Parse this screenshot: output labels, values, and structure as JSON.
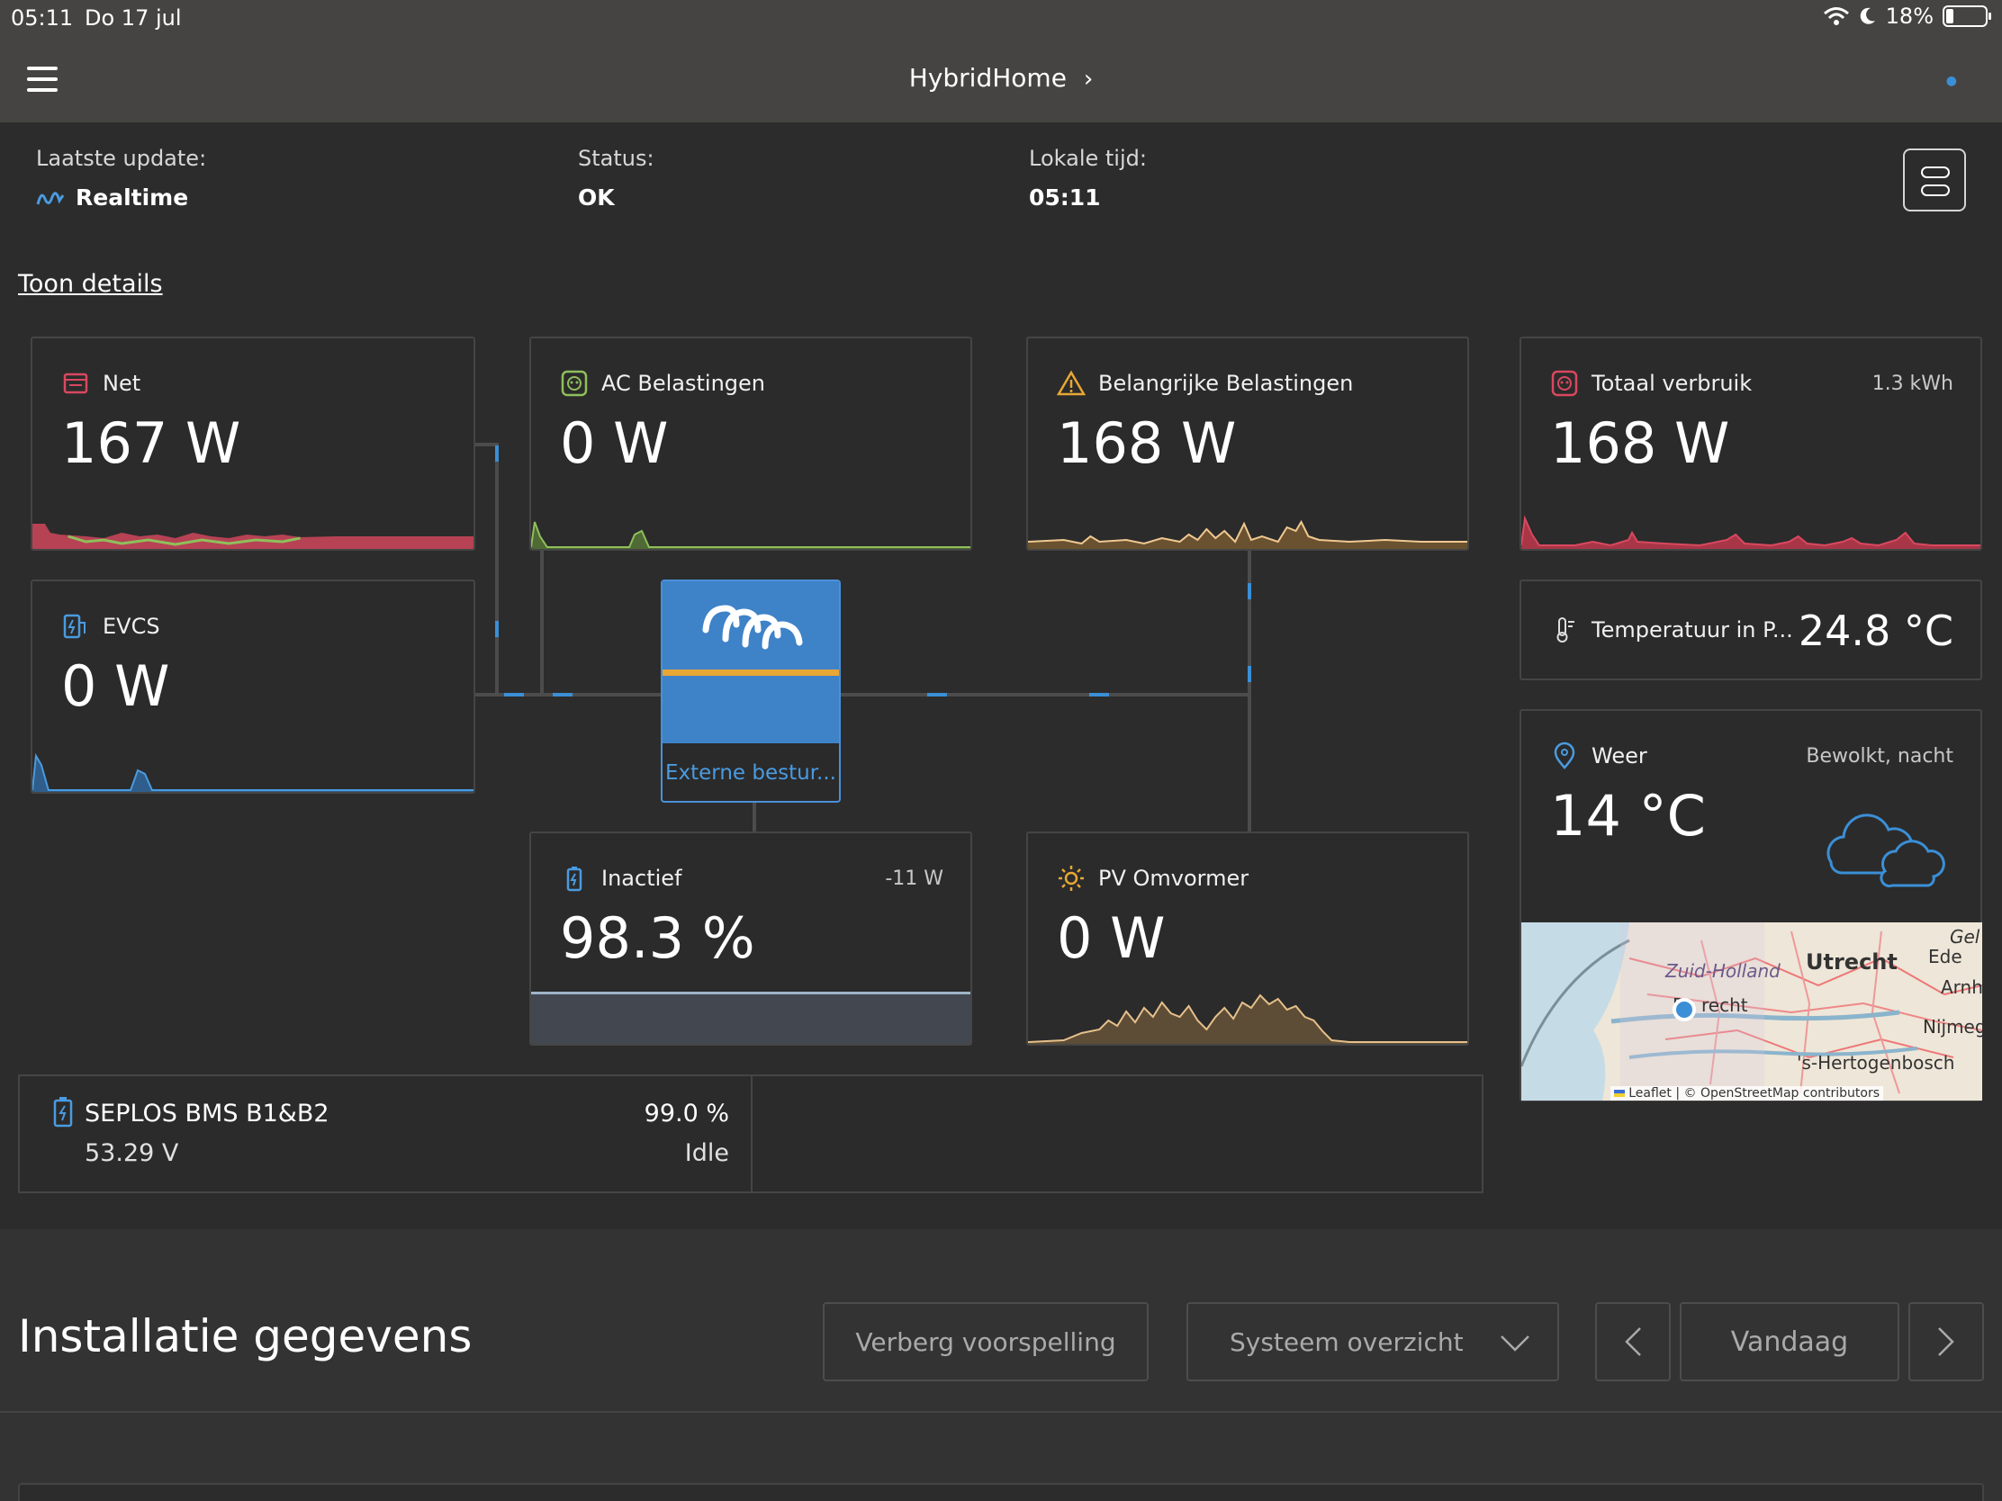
{
  "status_bar": {
    "time": "05:11",
    "date": "Do 17 jul",
    "battery": "18%"
  },
  "nav": {
    "title": "HybridHome"
  },
  "info": {
    "last_update_label": "Laatste update:",
    "last_update_value": "Realtime",
    "status_label": "Status:",
    "status_value": "OK",
    "local_time_label": "Lokale tijd:",
    "local_time_value": "05:11"
  },
  "toon_details": "Toon details",
  "cards": {
    "net": {
      "title": "Net",
      "value": "167 W"
    },
    "evcs": {
      "title": "EVCS",
      "value": "0 W"
    },
    "ac_loads": {
      "title": "AC Belastingen",
      "value": "0 W"
    },
    "critical_loads": {
      "title": "Belangrijke Belastingen",
      "value": "168 W"
    },
    "total_consumption": {
      "title": "Totaal verbruik",
      "value": "168 W",
      "extra": "1.3 kWh"
    },
    "temperature": {
      "title": "Temperatuur in P...",
      "value": "24.8 °C"
    },
    "weather": {
      "title": "Weer",
      "value": "14 °C",
      "condition": "Bewolkt, nacht"
    },
    "battery": {
      "title": "Inactief",
      "value": "98.3 %",
      "extra": "-11 W"
    },
    "pv": {
      "title": "PV Omvormer",
      "value": "0 W"
    }
  },
  "inverter": {
    "label": "Externe bestur..."
  },
  "map": {
    "labels": [
      "Utrecht",
      "Zuid-Holland",
      "Ede",
      "Gel",
      "Arnh",
      "Nijmeg",
      "'s-Hertogenbosch",
      "D",
      "recht"
    ],
    "attribution": "Leaflet | © OpenStreetMap contributors"
  },
  "bms": {
    "name": "SEPLOS BMS B1&B2",
    "voltage": "53.29 V",
    "soc": "99.0 %",
    "state": "Idle"
  },
  "bottom": {
    "title": "Installatie gegevens",
    "hide_forecast": "Verberg voorspelling",
    "overview_select": "Systeem overzicht",
    "today": "Vandaag"
  },
  "colors": {
    "accent_blue": "#3b8fd6",
    "net_red": "#d9485f",
    "ac_green": "#8fbf5a",
    "critical_orange": "#e8a734",
    "pv_tan": "#e6c08a"
  }
}
